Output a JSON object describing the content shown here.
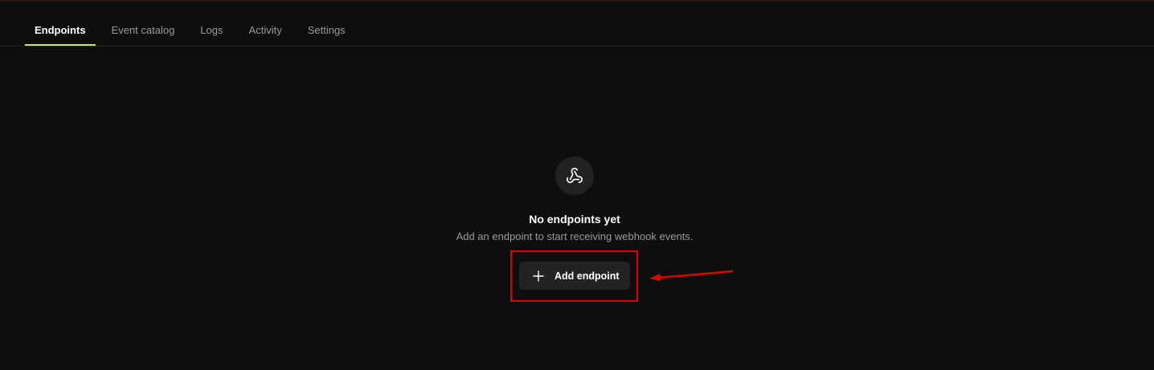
{
  "tabs": [
    {
      "label": "Endpoints",
      "active": true
    },
    {
      "label": "Event catalog",
      "active": false
    },
    {
      "label": "Logs",
      "active": false
    },
    {
      "label": "Activity",
      "active": false
    },
    {
      "label": "Settings",
      "active": false
    }
  ],
  "empty_state": {
    "icon": "webhook-icon",
    "title": "No endpoints yet",
    "subtitle": "Add an endpoint to start receiving webhook events.",
    "button_label": "Add endpoint",
    "button_icon": "plus-icon"
  },
  "annotation": {
    "color": "#e30000",
    "type": "highlight-box-with-arrow"
  },
  "colors": {
    "background": "#0e0e0e",
    "active_tab_underline": "#c6e96b",
    "button_background": "#232323"
  }
}
